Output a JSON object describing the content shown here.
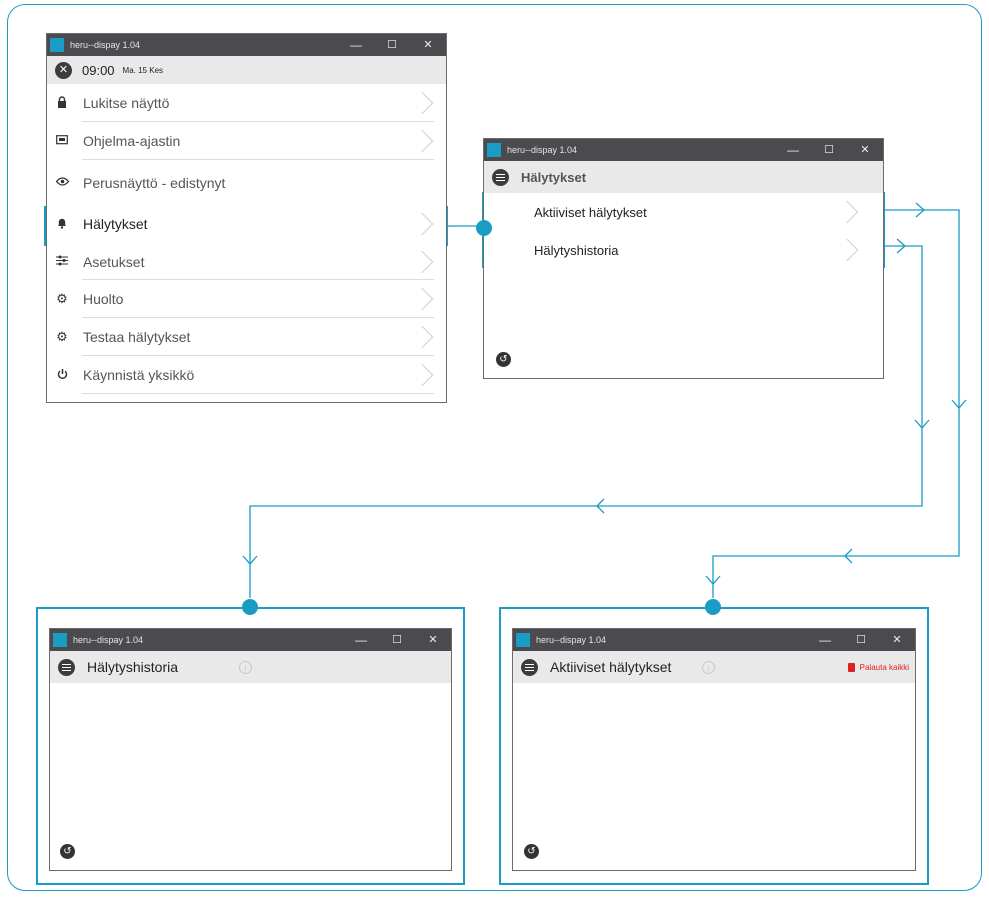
{
  "app": {
    "title": "heru--dispay 1.04",
    "controls": {
      "minimize": "—",
      "maximize": "☐",
      "close": "✕"
    }
  },
  "main_window": {
    "time": "09:00",
    "date": "Ma. 15 Kes",
    "close_glyph": "✕",
    "menu": [
      {
        "label": "Lukitse näyttö",
        "icon": "lock-icon"
      },
      {
        "label": "Ohjelma-ajastin",
        "icon": "timer-icon"
      },
      {
        "label": "Perusnäyttö - edistynyt",
        "icon": "eye-icon"
      },
      {
        "label": "Hälytykset",
        "icon": "bell-icon",
        "selected": true
      },
      {
        "label": "Asetukset",
        "icon": "sliders-icon"
      },
      {
        "label": "Huolto",
        "icon": "gear-icon"
      },
      {
        "label": "Testaa hälytykset",
        "icon": "gear-icon"
      },
      {
        "label": "Käynnistä yksikkö",
        "icon": "power-icon"
      }
    ]
  },
  "alarms_window": {
    "header": "Hälytykset",
    "items": [
      {
        "label": "Aktiiviset hälytykset",
        "icon": "chevron-right-icon"
      },
      {
        "label": "Hälytyshistoria",
        "icon": "chevron-right-icon"
      }
    ]
  },
  "history_window": {
    "header": "Hälytyshistoria",
    "info_glyph": "i"
  },
  "active_window": {
    "header": "Aktiiviset hälytykset",
    "info_glyph": "i",
    "reset_label": "Palauta kaikki"
  },
  "colors": {
    "accent": "#1a9cc4",
    "titlebar": "#4b4b4f",
    "header_bg": "#e9e9e9",
    "reset": "#e02020"
  }
}
